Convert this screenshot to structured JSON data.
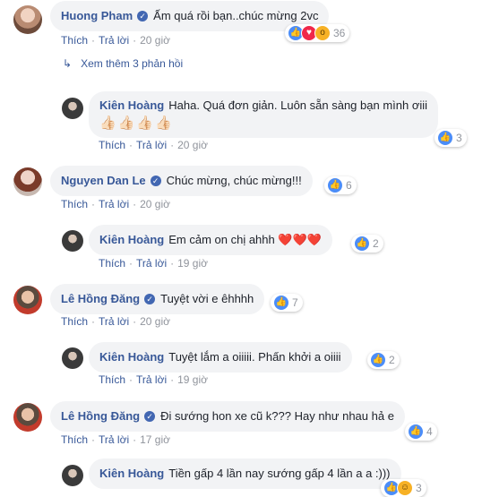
{
  "actions": {
    "like": "Thích",
    "reply": "Trả lời"
  },
  "view_more": "Xem thêm 3 phản hồi",
  "comments": [
    {
      "name": "Huong Pham",
      "text": "Ấm quá rồi bạn..chúc mừng 2vc",
      "time": "20 giờ",
      "reactions": [
        "like-icon",
        "love-icon",
        "wow-icon"
      ],
      "reaction_count": "36"
    },
    {
      "name": "Kiên Hoàng",
      "text": "Haha. Quá đơn giản. Luôn sẵn sàng bạn mình ơiii",
      "text2": "👍🏻👍🏻👍🏻👍🏻",
      "time": "20 giờ",
      "reactions": [
        "like-icon"
      ],
      "reaction_count": "3"
    },
    {
      "name": "Nguyen Dan Le",
      "text": "Chúc mừng, chúc mừng!!!",
      "time": "20 giờ",
      "reactions": [
        "like-icon"
      ],
      "reaction_count": "6"
    },
    {
      "name": "Kiên Hoàng",
      "text": "Em cảm on chị ahhh",
      "hearts": "❤️❤️❤️",
      "time": "19 giờ",
      "reactions": [
        "like-icon"
      ],
      "reaction_count": "2"
    },
    {
      "name": "Lê Hồng Đăng",
      "text": "Tuyệt vời e êhhhh",
      "time": "20 giờ",
      "reactions": [
        "like-icon"
      ],
      "reaction_count": "7"
    },
    {
      "name": "Kiên Hoàng",
      "text": "Tuyệt lắm a oiiiii. Phấn khởi a oiiii",
      "time": "19 giờ",
      "reactions": [
        "like-icon"
      ],
      "reaction_count": "2"
    },
    {
      "name": "Lê Hồng Đăng",
      "text": "Đi sướng hon xe cũ k??? Hay như nhau hả e",
      "time": "17 giờ",
      "reactions": [
        "like-icon"
      ],
      "reaction_count": "4"
    },
    {
      "name": "Kiên Hoàng",
      "text": "Tiền gấp 4 lần nay sướng gấp 4 lần a a :)))",
      "reactions": [
        "like-icon",
        "haha-icon"
      ],
      "reaction_count": "3"
    }
  ],
  "colors": {
    "link": "#385898",
    "meta": "#90949c",
    "bubble": "#f2f3f5",
    "like": "#4b8df8",
    "love": "#f0284a"
  }
}
